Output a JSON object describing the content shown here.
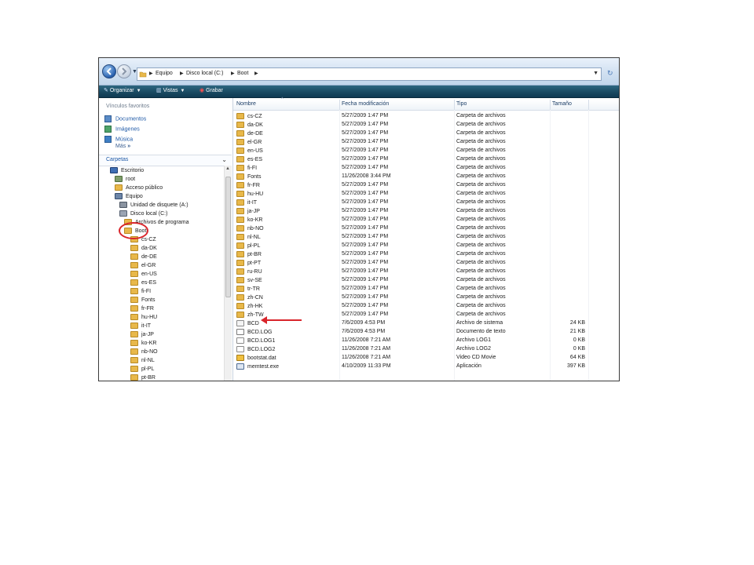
{
  "address_bar": {
    "crumbs": [
      "Equipo",
      "Disco local (C:)",
      "Boot"
    ]
  },
  "toolbar": {
    "organize": "Organizar",
    "views": "Vistas",
    "burn": "Grabar"
  },
  "left_pane": {
    "favorites_title": "Vínculos favoritos",
    "favorites": [
      {
        "label": "Documentos",
        "icon": "documents-icon"
      },
      {
        "label": "Imágenes",
        "icon": "pictures-icon"
      },
      {
        "label": "Música",
        "icon": "music-icon"
      }
    ],
    "more": "Más",
    "more_glyph": "»",
    "folders_header": "Carpetas",
    "tree": [
      {
        "label": "Escritorio",
        "level": 0,
        "icon": "desktop-icon"
      },
      {
        "label": "root",
        "level": 1,
        "icon": "user-folder-icon"
      },
      {
        "label": "Acceso público",
        "level": 1,
        "icon": "folder-icon"
      },
      {
        "label": "Equipo",
        "level": 1,
        "icon": "computer-icon"
      },
      {
        "label": "Unidad de disquete (A:)",
        "level": 2,
        "icon": "floppy-icon"
      },
      {
        "label": "Disco local (C:)",
        "level": 2,
        "icon": "drive-icon"
      },
      {
        "label": "Archivos de programa",
        "level": 3,
        "icon": "folder-icon"
      },
      {
        "label": "Boot",
        "level": 3,
        "icon": "folder-icon"
      },
      {
        "label": "cs-CZ",
        "level": 4,
        "icon": "folder-icon"
      },
      {
        "label": "da-DK",
        "level": 4,
        "icon": "folder-icon"
      },
      {
        "label": "de-DE",
        "level": 4,
        "icon": "folder-icon"
      },
      {
        "label": "el-GR",
        "level": 4,
        "icon": "folder-icon"
      },
      {
        "label": "en-US",
        "level": 4,
        "icon": "folder-icon"
      },
      {
        "label": "es-ES",
        "level": 4,
        "icon": "folder-icon"
      },
      {
        "label": "fi-FI",
        "level": 4,
        "icon": "folder-icon"
      },
      {
        "label": "Fonts",
        "level": 4,
        "icon": "folder-icon"
      },
      {
        "label": "fr-FR",
        "level": 4,
        "icon": "folder-icon"
      },
      {
        "label": "hu-HU",
        "level": 4,
        "icon": "folder-icon"
      },
      {
        "label": "it-IT",
        "level": 4,
        "icon": "folder-icon"
      },
      {
        "label": "ja-JP",
        "level": 4,
        "icon": "folder-icon"
      },
      {
        "label": "ko-KR",
        "level": 4,
        "icon": "folder-icon"
      },
      {
        "label": "nb-NO",
        "level": 4,
        "icon": "folder-icon"
      },
      {
        "label": "nl-NL",
        "level": 4,
        "icon": "folder-icon"
      },
      {
        "label": "pl-PL",
        "level": 4,
        "icon": "folder-icon"
      },
      {
        "label": "pt-BR",
        "level": 4,
        "icon": "folder-icon"
      }
    ]
  },
  "columns": [
    "Nombre",
    "Fecha modificación",
    "Tipo",
    "Tamaño"
  ],
  "files": [
    {
      "name": "cs-CZ",
      "date": "5/27/2009 1:47 PM",
      "type": "Carpeta de archivos",
      "size": "",
      "icon": "folder-icon"
    },
    {
      "name": "da-DK",
      "date": "5/27/2009 1:47 PM",
      "type": "Carpeta de archivos",
      "size": "",
      "icon": "folder-icon"
    },
    {
      "name": "de-DE",
      "date": "5/27/2009 1:47 PM",
      "type": "Carpeta de archivos",
      "size": "",
      "icon": "folder-icon"
    },
    {
      "name": "el-GR",
      "date": "5/27/2009 1:47 PM",
      "type": "Carpeta de archivos",
      "size": "",
      "icon": "folder-icon"
    },
    {
      "name": "en-US",
      "date": "5/27/2009 1:47 PM",
      "type": "Carpeta de archivos",
      "size": "",
      "icon": "folder-icon"
    },
    {
      "name": "es-ES",
      "date": "5/27/2009 1:47 PM",
      "type": "Carpeta de archivos",
      "size": "",
      "icon": "folder-icon"
    },
    {
      "name": "fi-FI",
      "date": "5/27/2009 1:47 PM",
      "type": "Carpeta de archivos",
      "size": "",
      "icon": "folder-icon"
    },
    {
      "name": "Fonts",
      "date": "11/26/2008 3:44 PM",
      "type": "Carpeta de archivos",
      "size": "",
      "icon": "folder-icon"
    },
    {
      "name": "fr-FR",
      "date": "5/27/2009 1:47 PM",
      "type": "Carpeta de archivos",
      "size": "",
      "icon": "folder-icon"
    },
    {
      "name": "hu-HU",
      "date": "5/27/2009 1:47 PM",
      "type": "Carpeta de archivos",
      "size": "",
      "icon": "folder-icon"
    },
    {
      "name": "it-IT",
      "date": "5/27/2009 1:47 PM",
      "type": "Carpeta de archivos",
      "size": "",
      "icon": "folder-icon"
    },
    {
      "name": "ja-JP",
      "date": "5/27/2009 1:47 PM",
      "type": "Carpeta de archivos",
      "size": "",
      "icon": "folder-icon"
    },
    {
      "name": "ko-KR",
      "date": "5/27/2009 1:47 PM",
      "type": "Carpeta de archivos",
      "size": "",
      "icon": "folder-icon"
    },
    {
      "name": "nb-NO",
      "date": "5/27/2009 1:47 PM",
      "type": "Carpeta de archivos",
      "size": "",
      "icon": "folder-icon"
    },
    {
      "name": "nl-NL",
      "date": "5/27/2009 1:47 PM",
      "type": "Carpeta de archivos",
      "size": "",
      "icon": "folder-icon"
    },
    {
      "name": "pl-PL",
      "date": "5/27/2009 1:47 PM",
      "type": "Carpeta de archivos",
      "size": "",
      "icon": "folder-icon"
    },
    {
      "name": "pt-BR",
      "date": "5/27/2009 1:47 PM",
      "type": "Carpeta de archivos",
      "size": "",
      "icon": "folder-icon"
    },
    {
      "name": "pt-PT",
      "date": "5/27/2009 1:47 PM",
      "type": "Carpeta de archivos",
      "size": "",
      "icon": "folder-icon"
    },
    {
      "name": "ru-RU",
      "date": "5/27/2009 1:47 PM",
      "type": "Carpeta de archivos",
      "size": "",
      "icon": "folder-icon"
    },
    {
      "name": "sv-SE",
      "date": "5/27/2009 1:47 PM",
      "type": "Carpeta de archivos",
      "size": "",
      "icon": "folder-icon"
    },
    {
      "name": "tr-TR",
      "date": "5/27/2009 1:47 PM",
      "type": "Carpeta de archivos",
      "size": "",
      "icon": "folder-icon"
    },
    {
      "name": "zh-CN",
      "date": "5/27/2009 1:47 PM",
      "type": "Carpeta de archivos",
      "size": "",
      "icon": "folder-icon"
    },
    {
      "name": "zh-HK",
      "date": "5/27/2009 1:47 PM",
      "type": "Carpeta de archivos",
      "size": "",
      "icon": "folder-icon"
    },
    {
      "name": "zh-TW",
      "date": "5/27/2009 1:47 PM",
      "type": "Carpeta de archivos",
      "size": "",
      "icon": "folder-icon"
    },
    {
      "name": "BCD",
      "date": "7/6/2009 4:53 PM",
      "type": "Archivo de sistema",
      "size": "24 KB",
      "icon": "system-file-icon"
    },
    {
      "name": "BCD.LOG",
      "date": "7/6/2009 4:53 PM",
      "type": "Documento de texto",
      "size": "21 KB",
      "icon": "text-file-icon"
    },
    {
      "name": "BCD.LOG1",
      "date": "11/26/2008 7:21 AM",
      "type": "Archivo LOG1",
      "size": "0 KB",
      "icon": "generic-file-icon"
    },
    {
      "name": "BCD.LOG2",
      "date": "11/26/2008 7:21 AM",
      "type": "Archivo LOG2",
      "size": "0 KB",
      "icon": "generic-file-icon"
    },
    {
      "name": "bootstat.dat",
      "date": "11/26/2008 7:21 AM",
      "type": "Video CD Movie",
      "size": "64 KB",
      "icon": "media-file-icon"
    },
    {
      "name": "memtest.exe",
      "date": "4/10/2009 11:33 PM",
      "type": "Aplicación",
      "size": "397 KB",
      "icon": "exe-file-icon"
    }
  ],
  "colors": {
    "folder": "#e8b84a",
    "link": "#1e59a7",
    "toolbar": "#1a4a62",
    "annotation": "#d9252b"
  }
}
